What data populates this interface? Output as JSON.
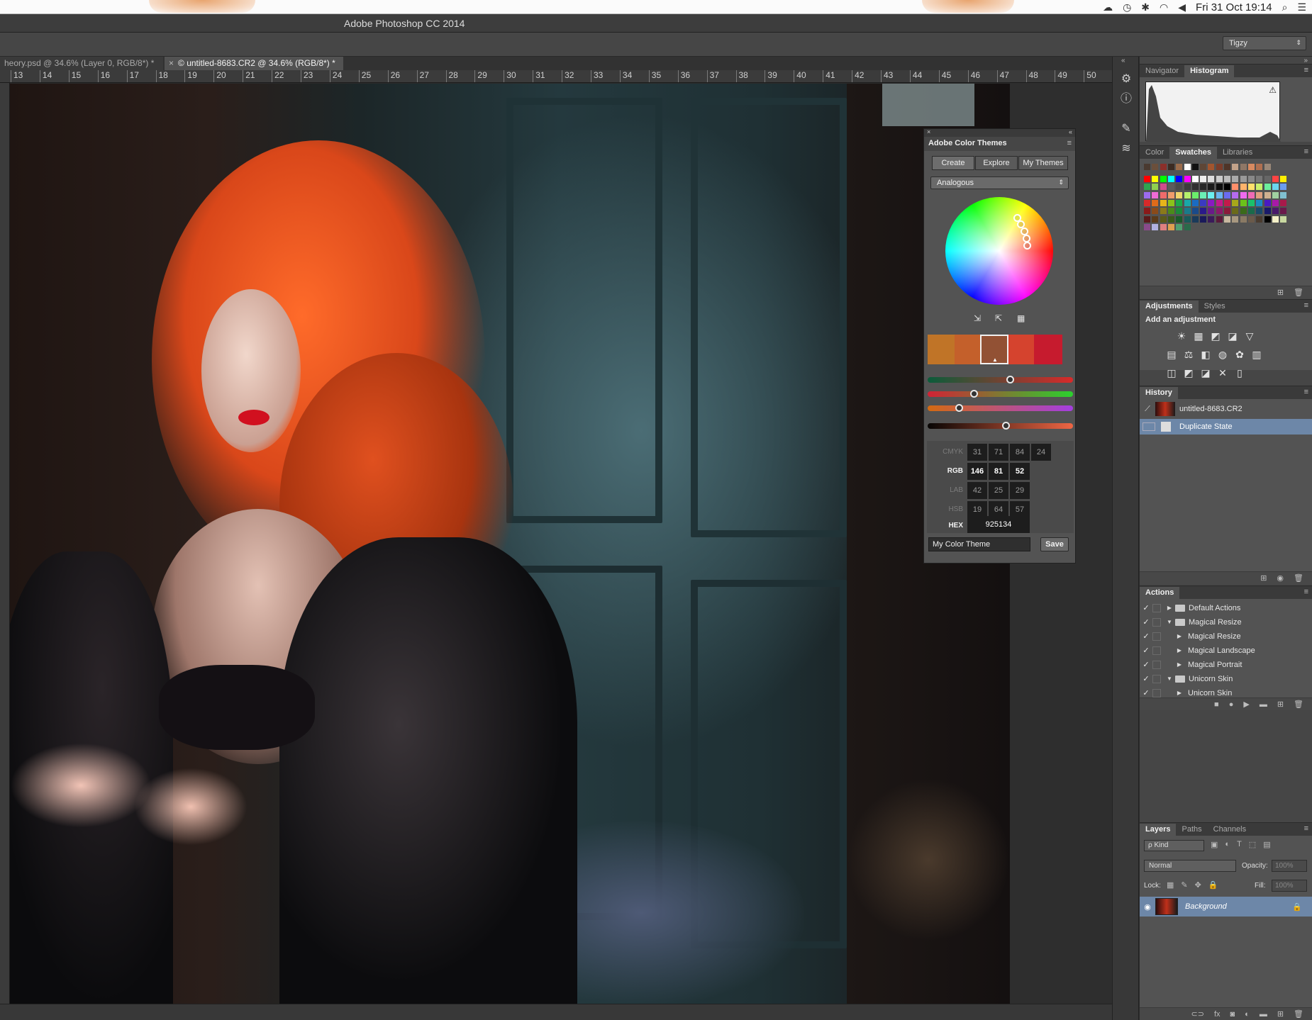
{
  "menubar": {
    "datetime": "Fri 31 Oct  19:14",
    "icons": [
      "creative-cloud-icon",
      "time-machine-icon",
      "bluetooth-icon",
      "wifi-icon",
      "volume-icon",
      "search-icon",
      "list-icon"
    ]
  },
  "app": {
    "title": "Adobe Photoshop CC 2014",
    "workspace": "Tigzy"
  },
  "tabs": [
    {
      "label": "heory.psd @ 34.6% (Layer 0, RGB/8*) *",
      "active": false
    },
    {
      "label": "© untitled-8683.CR2 @ 34.6% (RGB/8*) *",
      "active": true,
      "close": "×"
    }
  ],
  "ruler": {
    "ticks": [
      "13",
      "14",
      "15",
      "16",
      "17",
      "18",
      "19",
      "20",
      "21",
      "22",
      "23",
      "24",
      "25",
      "26",
      "27",
      "28",
      "29",
      "30",
      "31",
      "32",
      "33",
      "34",
      "35",
      "36",
      "37",
      "38",
      "39",
      "40",
      "41",
      "42",
      "43",
      "44",
      "45",
      "46",
      "47",
      "48",
      "49",
      "50"
    ]
  },
  "colorThemes": {
    "title": "Adobe Color Themes",
    "tabs": [
      "Create",
      "Explore",
      "My Themes"
    ],
    "harmony": "Analogous",
    "swatches": [
      "#c07427",
      "#c4602b",
      "#925134",
      "#d5432e",
      "#c61b2e"
    ],
    "sliders": [
      {
        "from": "#0a5c3a",
        "to": "#d92a2a",
        "pos": 0.57
      },
      {
        "from": "#d22235",
        "to": "#2bd12e",
        "pos": 0.32
      },
      {
        "from": "#d46a11",
        "to": "#a43ee0",
        "pos": 0.22
      },
      {
        "from": "#070504",
        "to": "#ef6644",
        "pos": 0.54
      }
    ],
    "values": {
      "rows": [
        {
          "label": "CMYK",
          "cells": [
            "31",
            "71",
            "84",
            "24"
          ],
          "active": false
        },
        {
          "label": "RGB",
          "cells": [
            "146",
            "81",
            "52"
          ],
          "active": true
        },
        {
          "label": "LAB",
          "cells": [
            "42",
            "25",
            "29"
          ],
          "active": false
        },
        {
          "label": "HSB",
          "cells": [
            "19",
            "64",
            "57"
          ],
          "active": false
        }
      ],
      "hex_label": "HEX",
      "hex": "925134"
    },
    "theme_name": "My Color Theme",
    "save_label": "Save"
  },
  "panels": {
    "nav": {
      "tabs": [
        "Navigator",
        "Histogram"
      ],
      "active": "Histogram",
      "warning": "⚠"
    },
    "color": {
      "tabs": [
        "Color",
        "Swatches",
        "Libraries"
      ],
      "active": "Swatches",
      "recent": [
        "#4a3a30",
        "#6b4f3b",
        "#8b2f2a",
        "#3c2b22",
        "#9b6b4a",
        "#ffffff",
        "#111111",
        "#5e4636",
        "#a3552e",
        "#7a3c2a",
        "#4f3428",
        "#c2a28a",
        "#8f7766",
        "#d88a60",
        "#b07050",
        "#9a8878"
      ],
      "swatches": [
        "#ff0000",
        "#ffff00",
        "#00ff00",
        "#00ffff",
        "#0000ff",
        "#ff00ff",
        "#ffffff",
        "#eeeeee",
        "#dddddd",
        "#cccccc",
        "#bbbbbb",
        "#aaaaaa",
        "#999999",
        "#888888",
        "#777777",
        "#666666",
        "#ff4444",
        "#ffee00",
        "#2ea44f",
        "#8fd14f",
        "#d24d8b",
        "#5c5c5c",
        "#4a4a4a",
        "#3c3c3c",
        "#303030",
        "#262626",
        "#1a1a1a",
        "#0d0d0d",
        "#000000",
        "#ff8f6b",
        "#ffb36b",
        "#ffe06b",
        "#c9ef6b",
        "#6bef9c",
        "#6bd5ef",
        "#6b9cef",
        "#9c6bef",
        "#ef6bd5",
        "#ef6b6b",
        "#ef9c6b",
        "#efd56b",
        "#b5ef6b",
        "#6bef6b",
        "#6befb5",
        "#6befef",
        "#6bb5ef",
        "#6b6bef",
        "#b56bef",
        "#ef6bef",
        "#ef6bb5",
        "#e0a080",
        "#d0b090",
        "#a0d0a0",
        "#80c0d0",
        "#d82a2a",
        "#e06b1a",
        "#e8b51a",
        "#8ac21a",
        "#1aa84a",
        "#1aa8a8",
        "#1a6bc2",
        "#3a3ac2",
        "#8a1ac2",
        "#c21a8a",
        "#c21a4a",
        "#a8a81a",
        "#6bc21a",
        "#1ac26b",
        "#1a8ac2",
        "#4a1ac2",
        "#a81aa8",
        "#a81a4a",
        "#8a1a1a",
        "#8a4a1a",
        "#8a7a1a",
        "#4a8a1a",
        "#1a8a3a",
        "#1a7a8a",
        "#1a4a8a",
        "#2a1a8a",
        "#6a1a8a",
        "#8a1a6a",
        "#8a1a3a",
        "#6a6a1a",
        "#3a6a1a",
        "#1a6a4a",
        "#1a4a6a",
        "#1a1a6a",
        "#4a1a6a",
        "#6a1a4a",
        "#5a1a1a",
        "#5a3a1a",
        "#5a5a1a",
        "#3a5a1a",
        "#1a5a2a",
        "#1a5a5a",
        "#1a3a5a",
        "#1a1a5a",
        "#3a1a5a",
        "#5a1a3a",
        "#c8b8a0",
        "#a89880",
        "#8a7a64",
        "#6a5a4a",
        "#4a3c30",
        "#000000",
        "#f5f0c8",
        "#c8d8a0",
        "#8a4a8a",
        "#b0b0e0",
        "#e08080",
        "#e0a050",
        "#50a070",
        "#2a6a4a"
      ]
    },
    "adjust": {
      "tabs": [
        "Adjustments",
        "Styles"
      ],
      "active": "Adjustments",
      "heading": "Add an adjustment",
      "rows": [
        [
          "☀",
          "▦",
          "◩",
          "◪",
          "▽"
        ],
        [
          "▤",
          "⚖",
          "◧",
          "◍",
          "✿",
          "▥"
        ],
        [
          "◫",
          "◩",
          "◪",
          "✕",
          "▯"
        ]
      ]
    },
    "history": {
      "tabs": [
        "History"
      ],
      "active": "History",
      "items": [
        {
          "label": "untitled-8683.CR2",
          "snapshot": true
        },
        {
          "label": "Duplicate State",
          "selected": true
        }
      ]
    },
    "actions": {
      "tabs": [
        "Actions"
      ],
      "active": "Actions",
      "items": [
        {
          "label": "Default Actions",
          "level": 0,
          "expanded": false,
          "folder": true
        },
        {
          "label": "Magical Resize",
          "level": 0,
          "expanded": true,
          "folder": true
        },
        {
          "label": "Magical Resize",
          "level": 1,
          "expanded": false,
          "folder": false
        },
        {
          "label": "Magical Landscape",
          "level": 1,
          "expanded": false,
          "folder": false
        },
        {
          "label": "Magical Portrait",
          "level": 1,
          "expanded": false,
          "folder": false
        },
        {
          "label": "Unicorn Skin",
          "level": 0,
          "expanded": true,
          "folder": true
        },
        {
          "label": "Unicorn Skin",
          "level": 1,
          "expanded": false,
          "folder": false
        }
      ]
    },
    "layers": {
      "tabs": [
        "Layers",
        "Paths",
        "Channels"
      ],
      "active": "Layers",
      "filter": "ρ Kind",
      "blend": "Normal",
      "opacity_label": "Opacity:",
      "opacity": "100%",
      "lock_label": "Lock:",
      "fill_label": "Fill:",
      "fill": "100%",
      "layer_name": "Background"
    }
  }
}
